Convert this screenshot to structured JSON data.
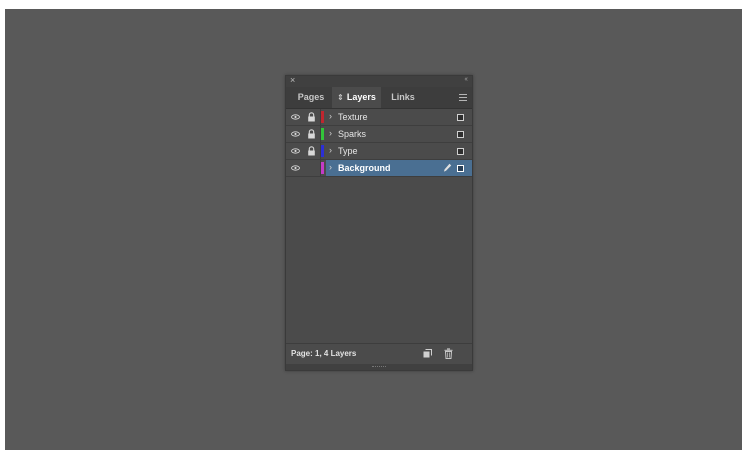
{
  "panel": {
    "close_glyph": "×",
    "collapse_glyph": "‹‹",
    "tabs": [
      {
        "label": "Pages"
      },
      {
        "label": "Layers"
      },
      {
        "label": "Links"
      }
    ],
    "active_tab_arrow": "⇕",
    "layers": [
      {
        "name": "Texture",
        "color": "#c0262f",
        "locked": true,
        "visible": true
      },
      {
        "name": "Sparks",
        "color": "#33c43a",
        "locked": true,
        "visible": true
      },
      {
        "name": "Type",
        "color": "#2c2fd6",
        "locked": true,
        "visible": true
      },
      {
        "name": "Background",
        "color": "#c43bc7",
        "locked": false,
        "visible": true,
        "selected": true
      }
    ],
    "expand_glyph": "›",
    "status_text": "Page: 1, 4 Layers",
    "icons": {
      "visibility": "eye-icon",
      "lock": "lock-icon",
      "edit": "pencil-icon",
      "new_layer": "new-layer-icon",
      "delete": "trash-icon",
      "menu": "menu-icon"
    },
    "colors": {
      "selection": "#4a6f92",
      "panel_bg": "#4b4b4b",
      "workspace_bg": "#595959"
    }
  }
}
